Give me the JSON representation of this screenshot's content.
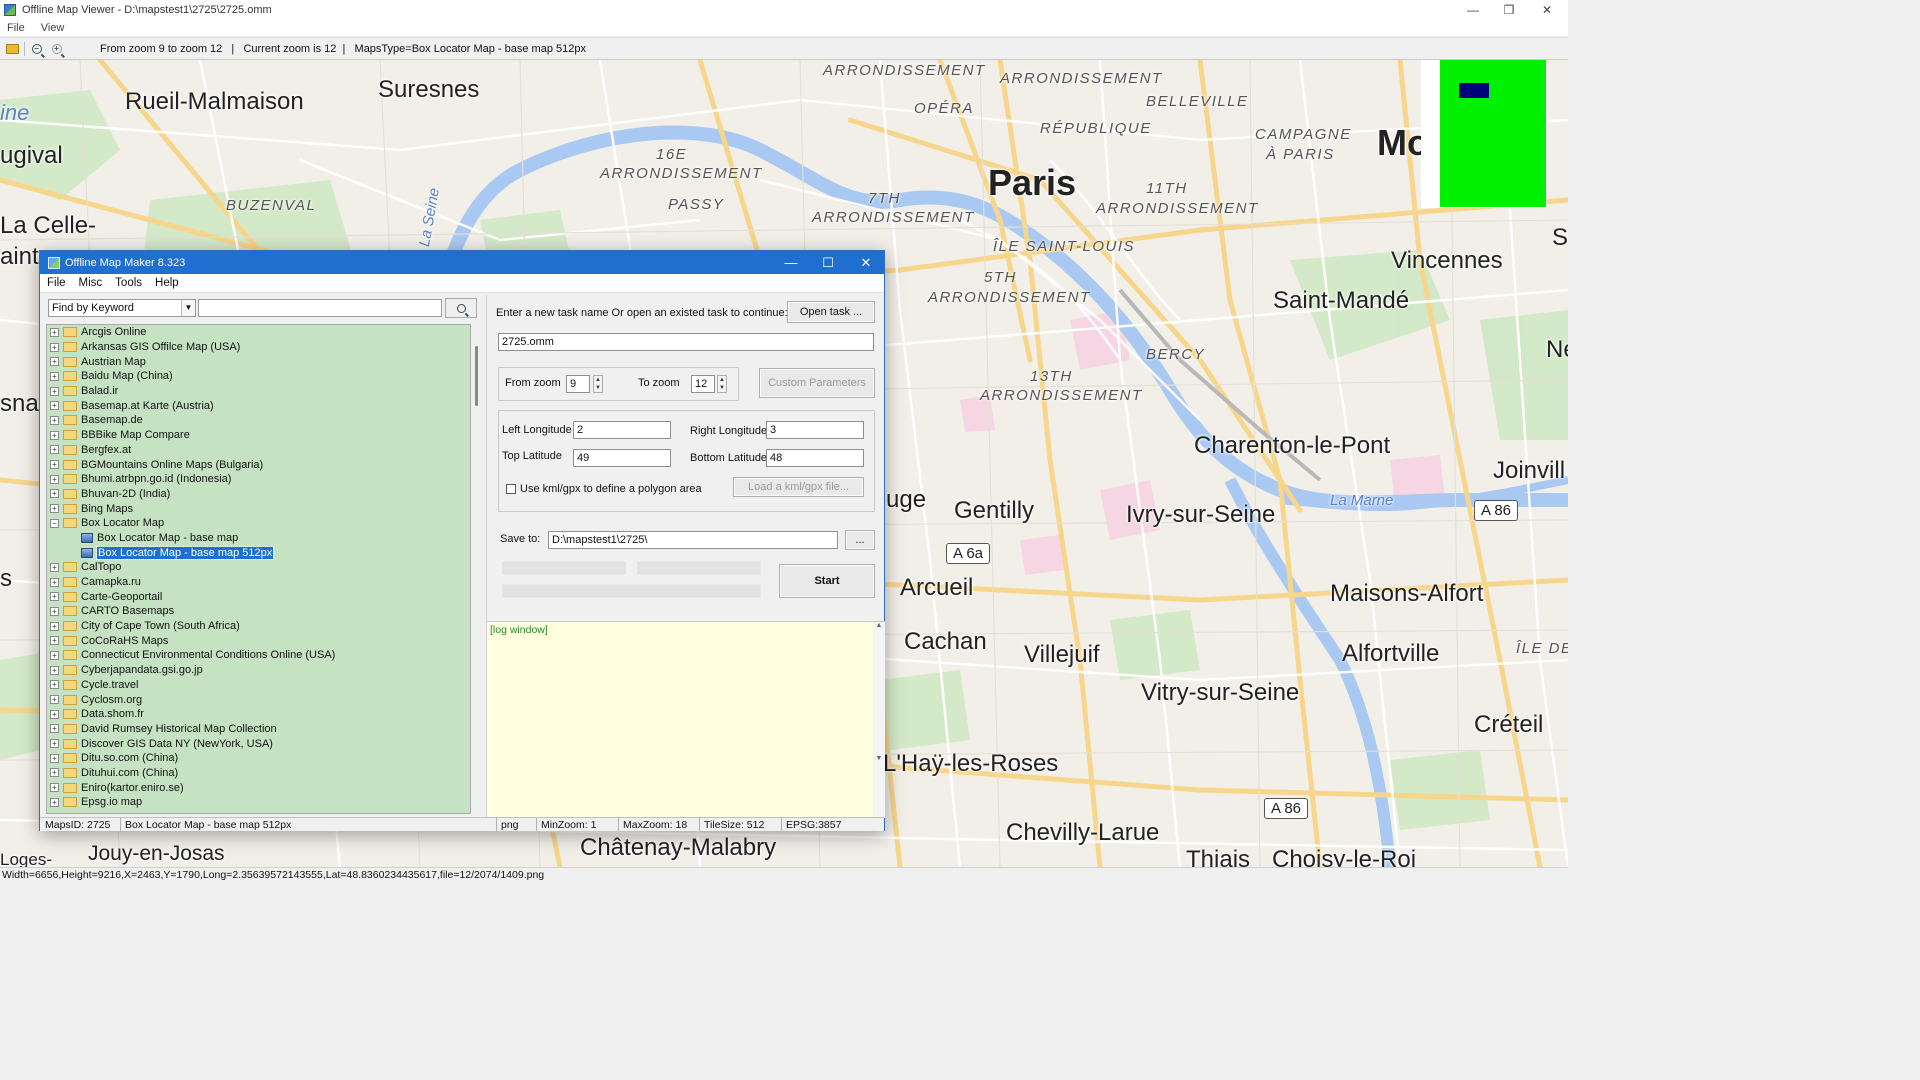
{
  "viewer": {
    "title": "Offline Map Viewer - D:\\mapstest1\\2725\\2725.omm",
    "menu": [
      "File",
      "View"
    ],
    "window_controls": {
      "minimize": "—",
      "restore": "❐",
      "close": "✕"
    },
    "toolbar_info": "From zoom 9 to zoom 12   |   Current zoom is 12  |   MapsType=Box Locator Map - base map 512px",
    "status_bar": "Width=6656,Height=9216,X=2463,Y=1790,Long=2.35639572143555,Lat=48.8360234435617,file=12/2074/1409.png"
  },
  "map": {
    "labels": {
      "rueil": "Rueil-Malmaison",
      "suresnes": "Suresnes",
      "paris": "Paris",
      "ugival": "ugival",
      "lacelle": "La Celle-",
      "aint": "aint-",
      "buzenval": "BUZENVAL",
      "ine": "ine",
      "sna": "sna",
      "s": "s",
      "arr_top": "ARRONDISSEMENT",
      "arr2": "ARRONDISSEMENT",
      "opera": "OPÉRA",
      "belleville": "BELLEVILLE",
      "republique": "RÉPUBLIQUE",
      "campagne1": "CAMPAGNE",
      "campagne2": "À PARIS",
      "mo": "Mo",
      "sixteen": "16E",
      "arr16": "ARRONDISSEMENT",
      "passy": "PASSY",
      "seventh": "7TH",
      "arr7": "ARRONDISSEMENT",
      "eleventh": "11TH",
      "arr11": "ARRONDISSEMENT",
      "ilestlouis": "ÎLE SAINT-LOUIS",
      "fifth": "5TH",
      "arr5": "ARRONDISSEMENT",
      "vincennes": "Vincennes",
      "saintmande": "Saint-Mandé",
      "bercy": "BERCY",
      "thirteenth": "13TH",
      "arr13": "ARRONDISSEMENT",
      "charenton": "Charenton-le-Pont",
      "joinvill": "Joinvill",
      "lamarne": "La Marne",
      "seine": "La Seine",
      "gentilly": "Gentilly",
      "ivry": "Ivry-sur-Seine",
      "uge": "uge",
      "arcueil": "Arcueil",
      "maisons": "Maisons-Alfort",
      "cachan": "Cachan",
      "villejuif": "Villejuif",
      "alfortville": "Alfortville",
      "iledefr": "ÎLE DE",
      "vitry": "Vitry-sur-Seine",
      "creteil": "Créteil",
      "hay": "L'Haÿ-les-Roses",
      "chevilly": "Chevilly-Larue",
      "thiais": "Thiais",
      "choisy": "Choisy-le-Roi",
      "jouy": "Jouy-en-Josas",
      "chatenay": "Châtenay-Malabry",
      "loges": "Loges-",
      "ne": "Ne",
      "sc": "Sc"
    },
    "shields": {
      "a6a": "A 6a",
      "a86a": "A 86",
      "a86b": "A 86"
    }
  },
  "dialog": {
    "title": "Offline Map Maker 8.323",
    "menu": [
      "File",
      "Misc",
      "Tools",
      "Help"
    ],
    "search_mode": "Find by Keyword",
    "search_value": "",
    "tree": [
      "Arcgis Online",
      "Arkansas GIS Offilce Map (USA)",
      "Austrian Map",
      "Baidu Map (China)",
      "Balad.ir",
      "Basemap.at Karte (Austria)",
      "Basemap.de",
      "BBBike Map Compare",
      "Bergfex.at",
      "BGMountains Online Maps (Bulgaria)",
      "Bhumi.atrbpn.go.id (Indonesia)",
      "Bhuvan-2D (India)",
      "Bing Maps",
      "Box Locator Map",
      "Box Locator Map - base map",
      "Box Locator Map - base map 512px",
      "CalTopo",
      "Camapka.ru",
      "Carte-Geoportail",
      "CARTO Basemaps",
      "City of Cape Town (South Africa)",
      "CoCoRaHS Maps",
      "Connecticut Environmental Conditions Online (USA)",
      "Cyberjapandata.gsi.go.jp",
      "Cycle.travel",
      "Cyclosm.org",
      "Data.shom.fr",
      "David Rumsey Historical Map Collection",
      "Discover GIS Data NY (NewYork, USA)",
      "Ditu.so.com (China)",
      "Dituhui.com (China)",
      "Eniro(kartor.eniro.se)",
      "Epsg.io map"
    ],
    "task_prompt": "Enter a new task name Or open an existed task to continue:",
    "open_task": "Open task ...",
    "task_name": "2725.omm",
    "from_zoom_label": "From zoom",
    "from_zoom": "9",
    "to_zoom_label": "To zoom",
    "to_zoom": "12",
    "custom_params": "Custom Parameters",
    "left_lon_label": "Left Longitude",
    "left_lon": "2",
    "right_lon_label": "Right Longitude",
    "right_lon": "3",
    "top_lat_label": "Top Latitude",
    "top_lat": "49",
    "bottom_lat_label": "Bottom Latitude",
    "bottom_lat": "48",
    "kml_label": "Use kml/gpx to define a polygon area",
    "load_kml": "Load a kml/gpx file...",
    "save_to_label": "Save to:",
    "save_to": "D:\\mapstest1\\2725\\",
    "browse": "...",
    "start": "Start",
    "log": "[log window]",
    "status": {
      "maps_id": "MapsID: 2725",
      "map_name": "Box Locator Map - base map 512px",
      "format": "png",
      "min_zoom": "MinZoom: 1",
      "max_zoom": "MaxZoom: 18",
      "tile_size": "TileSize: 512",
      "epsg": "EPSG:3857"
    },
    "window_controls": {
      "minimize": "—",
      "maximize": "☐",
      "close": "✕"
    }
  }
}
